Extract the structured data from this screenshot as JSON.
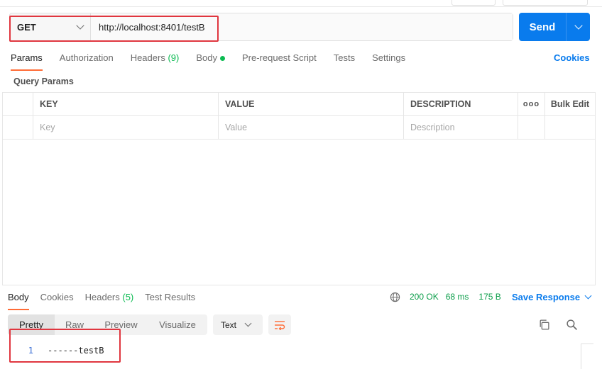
{
  "request": {
    "method": "GET",
    "url": "http://localhost:8401/testB",
    "send_label": "Send"
  },
  "request_tabs": [
    {
      "label": "Params",
      "active": true
    },
    {
      "label": "Authorization"
    },
    {
      "label": "Headers",
      "count": "(9)"
    },
    {
      "label": "Body",
      "dot": true
    },
    {
      "label": "Pre-request Script"
    },
    {
      "label": "Tests"
    },
    {
      "label": "Settings"
    }
  ],
  "cookies_link": "Cookies",
  "query_params": {
    "title": "Query Params",
    "columns": [
      "KEY",
      "VALUE",
      "DESCRIPTION"
    ],
    "more_label": "ooo",
    "bulk_edit": "Bulk Edit",
    "placeholders": {
      "key": "Key",
      "value": "Value",
      "description": "Description"
    }
  },
  "response_tabs": [
    {
      "label": "Body",
      "active": true
    },
    {
      "label": "Cookies"
    },
    {
      "label": "Headers",
      "count": "(5)"
    },
    {
      "label": "Test Results"
    }
  ],
  "response_status": {
    "status": "200 OK",
    "time": "68 ms",
    "size": "175 B",
    "save_label": "Save Response"
  },
  "view_modes": [
    "Pretty",
    "Raw",
    "Preview",
    "Visualize"
  ],
  "format": "Text",
  "body_lines": [
    {
      "n": "1",
      "text": "------testB"
    }
  ],
  "colors": {
    "accent": "#097bed",
    "tab_active": "#ff6c37",
    "ok": "#0c9e4a",
    "highlight": "#e0363f"
  }
}
